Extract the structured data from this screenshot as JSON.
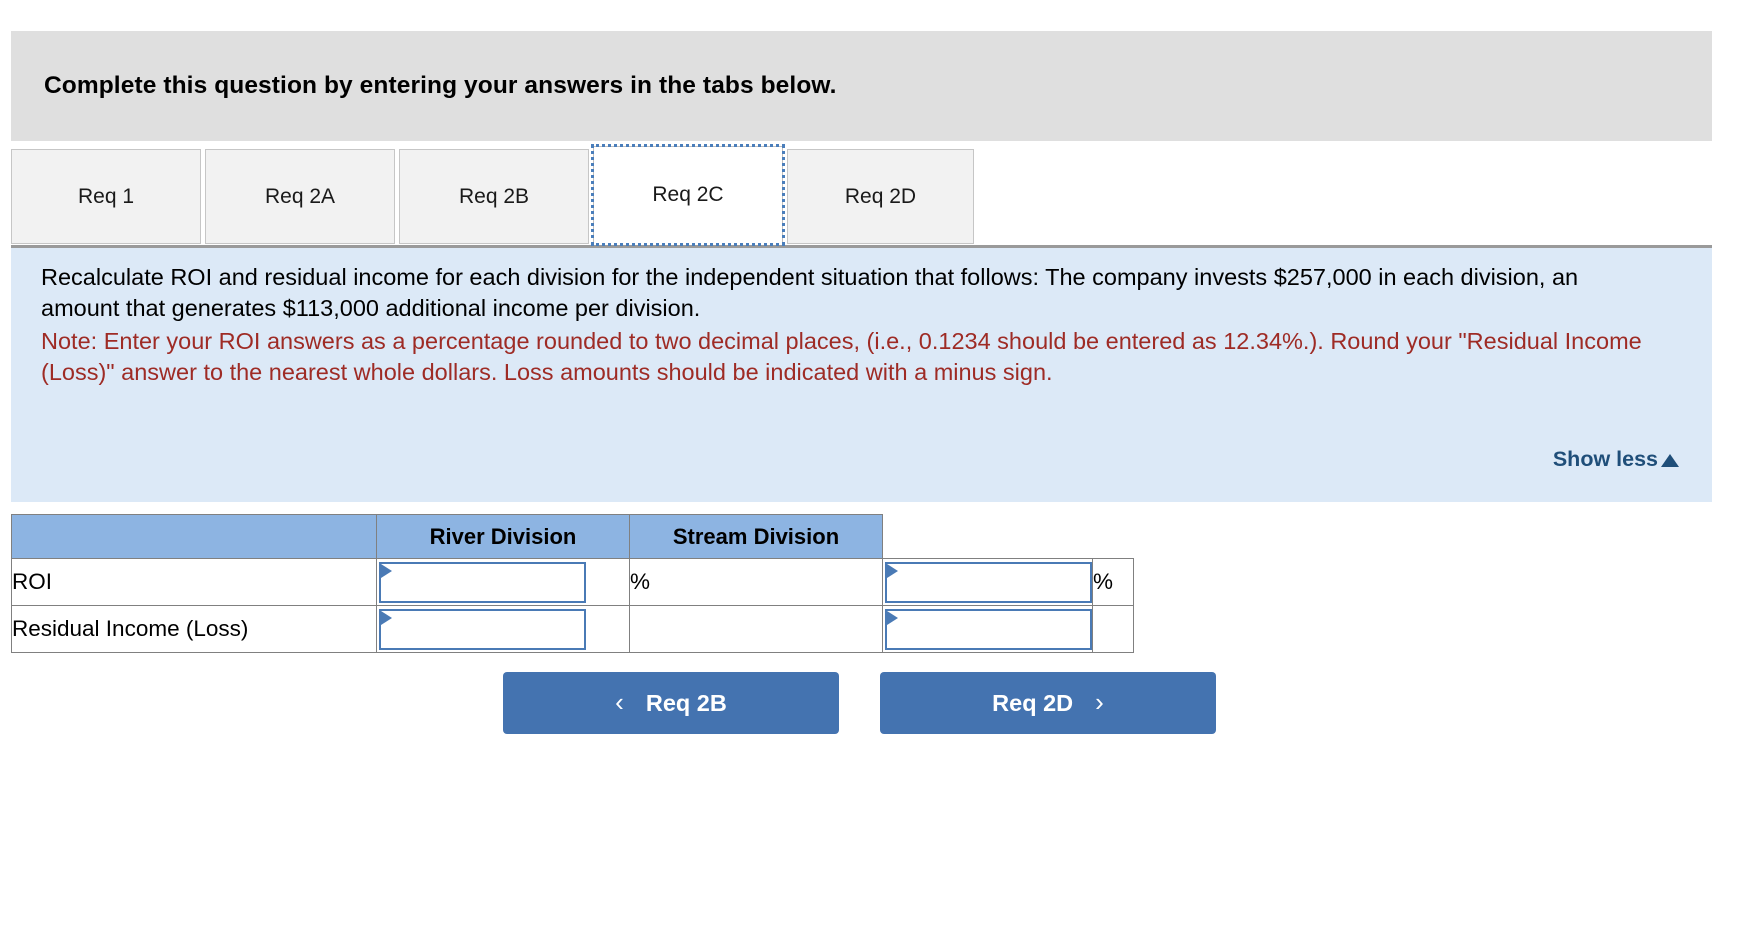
{
  "banner": {
    "text": "Complete this question by entering your answers in the tabs below."
  },
  "tabs": {
    "items": [
      {
        "label": "Req 1",
        "active": false
      },
      {
        "label": "Req 2A",
        "active": false
      },
      {
        "label": "Req 2B",
        "active": false
      },
      {
        "label": "Req 2C",
        "active": true
      },
      {
        "label": "Req 2D",
        "active": false
      }
    ]
  },
  "instructions": {
    "main": "Recalculate ROI and residual income for each division for the independent situation that follows: The company invests $257,000 in each division, an amount that generates $113,000 additional income per division.",
    "note": "Note: Enter your ROI answers as a percentage rounded to two decimal places, (i.e., 0.1234 should be entered as 12.34%.). Round your \"Residual Income (Loss)\" answer to the nearest whole dollars. Loss amounts should be indicated with a minus sign.",
    "show_less_label": "Show less",
    "show_less_icon": "caret-up-icon",
    "panel_color": "#dce9f7",
    "note_color": "#9e2b25",
    "link_color": "#1f4e79"
  },
  "answer_table": {
    "header_color": "#8db4e2",
    "input_border_color": "#4a7ab5",
    "columns": [
      "",
      "River Division",
      "Stream Division"
    ],
    "rows": [
      {
        "label": "ROI",
        "river_value": "",
        "river_suffix": "%",
        "stream_value": "",
        "stream_suffix": "%"
      },
      {
        "label": "Residual Income (Loss)",
        "river_value": "",
        "river_suffix": "",
        "stream_value": "",
        "stream_suffix": ""
      }
    ],
    "input_placeholder": ""
  },
  "navigation": {
    "prev_label": "Req 2B",
    "prev_icon": "chevron-left-icon",
    "next_label": "Req 2D",
    "next_icon": "chevron-right-icon",
    "button_color": "#4473b0"
  }
}
